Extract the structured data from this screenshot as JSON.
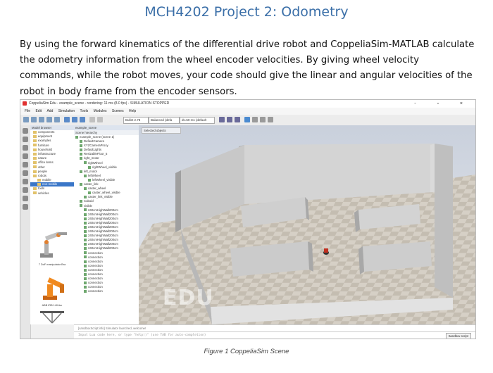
{
  "document": {
    "title": "MCH4202 Project 2: Odometry",
    "paragraph": "By using the forward kinematics of the differential drive robot and CoppeliaSim-MATLAB calculate the odometry information from the wheel encoder velocities. By giving wheel velocity commands, while the robot moves, your code should give the linear and angular velocities of the robot in body frame from the encoder sensors.",
    "caption": "Figure 1 CoppeliaSim Scene"
  },
  "screenshot": {
    "window_title": "CoppeliaSim Edu - example_scene - rendering: 11 ms (8.0 fps) - SIMULATION STOPPED",
    "window_controls": "- ▫ ×",
    "menu": [
      "File",
      "Edit",
      "Add",
      "Simulation",
      "Tools",
      "Modules",
      "Scenes",
      "Help"
    ],
    "toolbar_dropdowns": [
      "Bullet 2.78",
      "Balanced (defa",
      "dt=50 ms (default"
    ],
    "model_browser_title": "Model browser",
    "model_browser_items": [
      "components",
      "equipment",
      "examples",
      "furniture",
      "household",
      "infrastructure",
      "nature",
      "office items",
      "other",
      "people",
      "robots",
      "mobile",
      "non-mobile",
      "tools",
      "vehicles"
    ],
    "model_browser_selected": "non-mobile",
    "thumb1_caption": "7 DoF manipulator Bra",
    "thumb2_caption": "ABB IRB 140.ttm",
    "scene_hierarchy_tab": "example_scene",
    "scene_hierarchy_title": "Scene hierarchy",
    "hierarchy_items": [
      "example_scene (scene 1)",
      "DefaultCamera",
      "XYZCameraProxy",
      "DefaultLights",
      "ResizableFloor_5",
      "right_motor",
      "rightWheel",
      "rightWheel_visible",
      "left_motor",
      "leftWheel",
      "leftWheel_visible",
      "caster_link",
      "caster_wheel",
      "caster_wheel_visible",
      "caster_link_visible",
      "Cuboid",
      "visible",
      "240cmHighWall200cm",
      "240cmHighWall200cm",
      "240cmHighWall200cm",
      "240cmHighWall200cm",
      "240cmHighWall200cm",
      "240cmHighWall200cm",
      "240cmHighWall200cm",
      "240cmHighWall200cm",
      "240cmHighWall200cm",
      "240cmHighWall200cm",
      "connection",
      "connection",
      "connection",
      "connection",
      "connection",
      "connection",
      "connection",
      "connection",
      "connection",
      "connection"
    ],
    "selected_objects_label": "Selected objects",
    "watermark": "EDU",
    "status_text": "[sandboxScript:info] Simulator launched, welcome!",
    "command_placeholder": "Input Lua code here, or type \"help()\" (use TAB for auto-completion)",
    "sandbox_label": "Sandbox script"
  }
}
